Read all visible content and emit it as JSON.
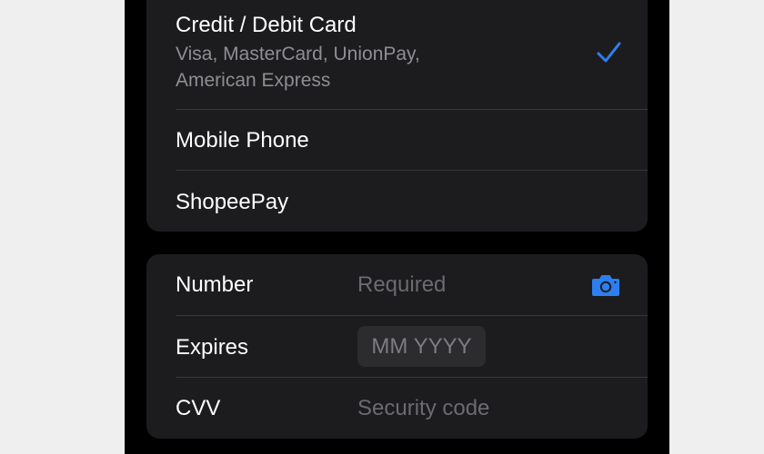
{
  "payment_methods": {
    "items": [
      {
        "title": "Credit / Debit Card",
        "subtitle": "Visa, MasterCard, UnionPay, American Express",
        "selected": true
      },
      {
        "title": "Mobile Phone",
        "selected": false
      },
      {
        "title": "ShopeePay",
        "selected": false
      }
    ],
    "checkmark_icon": "checkmark-icon",
    "accent_color": "#2c7ff0"
  },
  "card_form": {
    "number": {
      "label": "Number",
      "placeholder": "Required"
    },
    "expires": {
      "label": "Expires",
      "placeholder": "MM YYYY"
    },
    "cvv": {
      "label": "CVV",
      "placeholder": "Security code"
    },
    "scan_icon": "camera-icon"
  },
  "colors": {
    "background": "#000000",
    "group_background": "#1c1c1e",
    "separator": "#38383a",
    "secondary_text": "#8e8e93",
    "placeholder_text": "#6b6b70",
    "accent": "#2c7ff0"
  }
}
